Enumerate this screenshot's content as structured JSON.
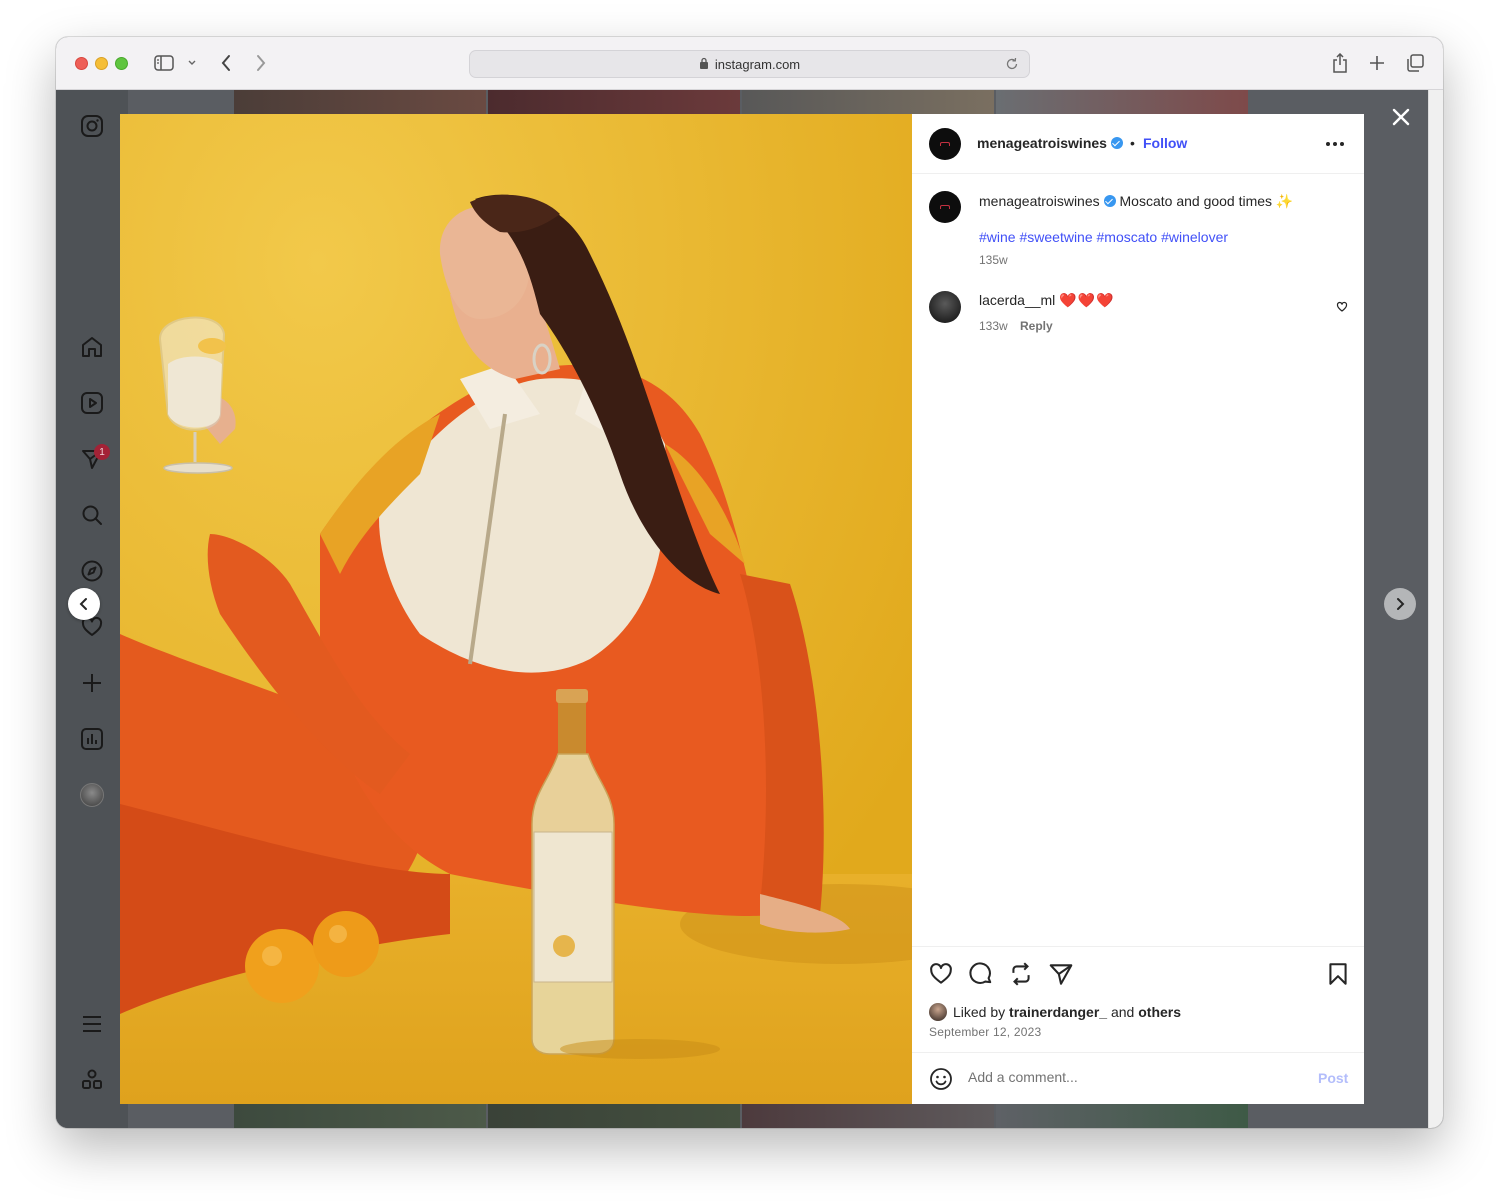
{
  "browser": {
    "url": "instagram.com"
  },
  "sidebar": {
    "notification_count": "1"
  },
  "post": {
    "username": "menageatroiswines",
    "follow_label": "Follow",
    "separator": "•",
    "caption": {
      "username": "menageatroiswines",
      "text": "Moscato and good times ✨",
      "hashtags": "#wine #sweetwine #moscato #winelover",
      "time": "135w"
    },
    "comments": [
      {
        "username": "lacerda__ml",
        "text": "❤️❤️❤️",
        "time": "133w",
        "reply_label": "Reply"
      }
    ],
    "likes": {
      "prefix": "Liked by",
      "user": "trainerdanger_",
      "middle": "and",
      "others": "others"
    },
    "date": "September 12, 2023",
    "comment_box": {
      "placeholder": "Add a comment...",
      "post_label": "Post"
    }
  },
  "colors": {
    "accent": "#4150f7",
    "photo_background": "#e9b427",
    "badge": "#a32236"
  }
}
